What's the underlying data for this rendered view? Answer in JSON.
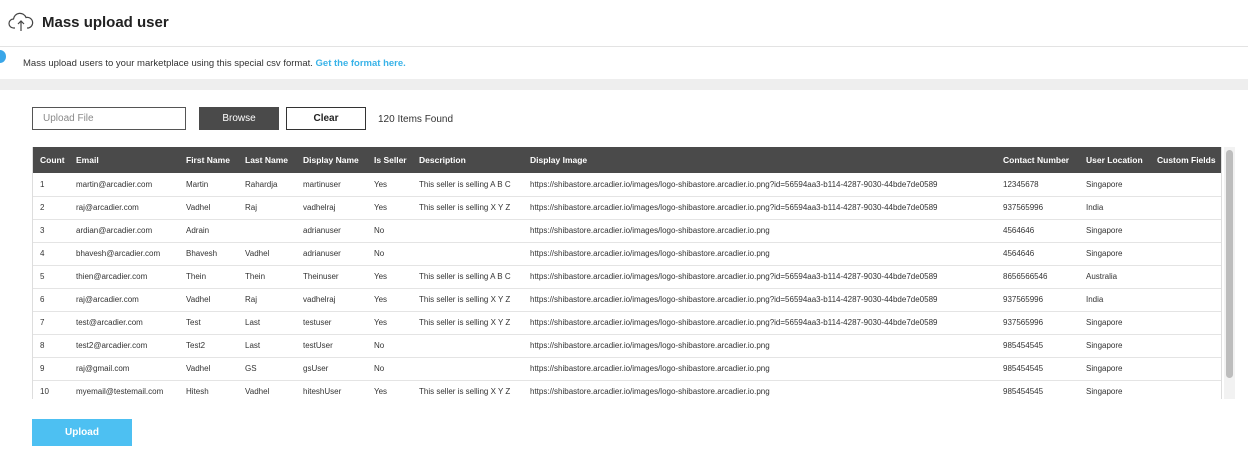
{
  "header": {
    "title": "Mass upload user",
    "icon": "cloud-upload-icon"
  },
  "info": {
    "text": "Mass upload users to your marketplace using this special csv format.",
    "link_text": "Get the format here."
  },
  "upload": {
    "placeholder": "Upload File",
    "browse_label": "Browse",
    "clear_label": "Clear",
    "items_found": "120 Items Found",
    "upload_label": "Upload"
  },
  "table": {
    "columns": [
      "Count",
      "Email",
      "First Name",
      "Last Name",
      "Display Name",
      "Is Seller",
      "Description",
      "Display Image",
      "Contact Number",
      "User Location",
      "Custom Fields"
    ],
    "rows": [
      [
        "1",
        "martin@arcadier.com",
        "Martin",
        "Rahardja",
        "martinuser",
        "Yes",
        "This seller is selling A B C",
        "https://shibastore.arcadier.io/images/logo-shibastore.arcadier.io.png?id=56594aa3-b114-4287-9030-44bde7de0589",
        "12345678",
        "Singapore",
        ""
      ],
      [
        "2",
        "raj@arcadier.com",
        "Vadhel",
        "Raj",
        "vadhelraj",
        "Yes",
        "This seller is selling X Y Z",
        "https://shibastore.arcadier.io/images/logo-shibastore.arcadier.io.png?id=56594aa3-b114-4287-9030-44bde7de0589",
        "937565996",
        "India",
        ""
      ],
      [
        "3",
        "ardian@arcadier.com",
        "Adrain",
        "",
        "adrianuser",
        "No",
        "",
        "https://shibastore.arcadier.io/images/logo-shibastore.arcadier.io.png",
        "4564646",
        "Singapore",
        ""
      ],
      [
        "4",
        "bhavesh@arcadier.com",
        "Bhavesh",
        "Vadhel",
        "adrianuser",
        "No",
        "",
        "https://shibastore.arcadier.io/images/logo-shibastore.arcadier.io.png",
        "4564646",
        "Singapore",
        ""
      ],
      [
        "5",
        "thien@arcadier.com",
        "Thein",
        "Thein",
        "Theinuser",
        "Yes",
        "This seller is selling A B C",
        "https://shibastore.arcadier.io/images/logo-shibastore.arcadier.io.png?id=56594aa3-b114-4287-9030-44bde7de0589",
        "8656566546",
        "Australia",
        ""
      ],
      [
        "6",
        "raj@arcadier.com",
        "Vadhel",
        "Raj",
        "vadhelraj",
        "Yes",
        "This seller is selling X Y Z",
        "https://shibastore.arcadier.io/images/logo-shibastore.arcadier.io.png?id=56594aa3-b114-4287-9030-44bde7de0589",
        "937565996",
        "India",
        ""
      ],
      [
        "7",
        "test@arcadier.com",
        "Test",
        "Last",
        "testuser",
        "Yes",
        "This seller is selling X Y Z",
        "https://shibastore.arcadier.io/images/logo-shibastore.arcadier.io.png?id=56594aa3-b114-4287-9030-44bde7de0589",
        "937565996",
        "Singapore",
        ""
      ],
      [
        "8",
        "test2@arcadier.com",
        "Test2",
        "Last",
        "testUser",
        "No",
        "",
        "https://shibastore.arcadier.io/images/logo-shibastore.arcadier.io.png",
        "985454545",
        "Singapore",
        ""
      ],
      [
        "9",
        "raj@gmail.com",
        "Vadhel",
        "GS",
        "gsUser",
        "No",
        "",
        "https://shibastore.arcadier.io/images/logo-shibastore.arcadier.io.png",
        "985454545",
        "Singapore",
        ""
      ],
      [
        "10",
        "myemail@testemail.com",
        "Hitesh",
        "Vadhel",
        "hiteshUser",
        "Yes",
        "This seller is selling X Y Z",
        "https://shibastore.arcadier.io/images/logo-shibastore.arcadier.io.png",
        "985454545",
        "Singapore",
        ""
      ]
    ]
  }
}
